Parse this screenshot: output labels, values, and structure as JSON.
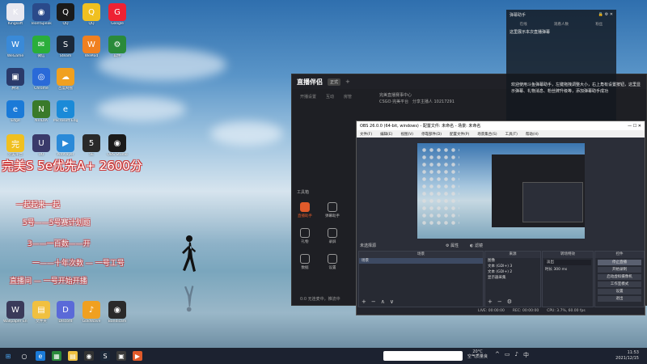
{
  "desktop": {
    "icons": [
      {
        "label": "Kingsoft",
        "color": "#e8e8f0",
        "glyph": "K"
      },
      {
        "label": "TeamSpeak",
        "color": "#2a4a8a",
        "glyph": "◉"
      },
      {
        "label": "QQ",
        "color": "#1a1a1a",
        "glyph": "Q"
      },
      {
        "label": "QQ",
        "color": "#f0c020",
        "glyph": "Q"
      },
      {
        "label": "Google",
        "color": "#e23",
        "glyph": "G"
      },
      {
        "label": "WeGame",
        "color": "#3a8ad8",
        "glyph": "W"
      },
      {
        "label": "微信",
        "color": "#2aae3a",
        "glyph": "✉"
      },
      {
        "label": "Steam",
        "color": "#1b2838",
        "glyph": "S"
      },
      {
        "label": "WeMod",
        "color": "#f08020",
        "glyph": "W"
      },
      {
        "label": "软件",
        "color": "#2a8a3a",
        "glyph": "⚙"
      },
      {
        "label": "腾讯",
        "color": "#2a3a6a",
        "glyph": "▣"
      },
      {
        "label": "Chrome",
        "color": "#2a6ad8",
        "glyph": "◎"
      },
      {
        "label": "百度网盘",
        "color": "#f0a020",
        "glyph": "☁"
      },
      {
        "label": "Edge",
        "color": "#1a7ad8",
        "glyph": "e"
      },
      {
        "label": "NVIDIA",
        "color": "#3a7a2a",
        "glyph": "N"
      },
      {
        "label": "Microsoft Edge",
        "color": "#1a8ad8",
        "glyph": "e"
      },
      {
        "label": "完美平台",
        "color": "#f0c020",
        "glyph": "完"
      },
      {
        "label": "UU",
        "color": "#3a3a6a",
        "glyph": "U"
      },
      {
        "label": "PotPlayer",
        "color": "#2a8ad8",
        "glyph": "▶"
      },
      {
        "label": "5E",
        "color": "#2a2a2a",
        "glyph": "5"
      },
      {
        "label": "OBS Studio",
        "color": "#1a1a1a",
        "glyph": "◉"
      },
      {
        "label": "Wallpaper Engine",
        "color": "#3a3a5a",
        "glyph": "W"
      },
      {
        "label": "文件夹",
        "color": "#f0c040",
        "glyph": "▤"
      },
      {
        "label": "Discord",
        "color": "#5a6ad8",
        "glyph": "D"
      },
      {
        "label": "GoldWave",
        "color": "#f0a020",
        "glyph": "♪"
      },
      {
        "label": "Bandicam",
        "color": "#2a2a2a",
        "glyph": "◉"
      }
    ],
    "overlay_big": "完美S 5e优先A+ 2600分",
    "overlay_lines": [
      "一起起来一起",
      "5号——5号赛计划题",
      "3——一百数——开",
      "一——十年次数 — 一号工号",
      "直播间 — 一号开始开播"
    ]
  },
  "live_app": {
    "logo": "直播伴侣",
    "badge": "正式",
    "tabs": [
      "开播设置",
      "互动",
      "房管"
    ],
    "info_lines": [
      "完美直播赛事中心",
      "CSGO·完美平台",
      "分享主播人",
      "10217291"
    ],
    "tools_label": "工具箱",
    "tools": [
      {
        "label": "直播助手",
        "active": true
      },
      {
        "label": "弹幕助手",
        "active": false
      },
      {
        "label": "礼物",
        "active": false
      },
      {
        "label": "录屏",
        "active": false
      },
      {
        "label": "数据",
        "active": false
      },
      {
        "label": "设置",
        "active": false
      }
    ],
    "status": "0:0 无连麦中，推流中"
  },
  "chat": {
    "title": "弹幕助手",
    "stats": [
      "在线",
      "观看人数",
      "粉丝"
    ],
    "message": "这里展示本次直播弹幕",
    "welcome": "欢迎使用斗鱼弹幕助手，左键拖拽调整大小，右上角有设置按钮，这里显示弹幕、礼物消息、粉丝牌升级等，添加弹幕助手成功"
  },
  "obs": {
    "title": "OBS 26.0.0 (64-bit, windows) - 配置文件: 未命名 - 场景: 未命名",
    "menu": [
      "文件(F)",
      "编辑(E)",
      "视图(V)",
      "停靠部件(D)",
      "配置文件(P)",
      "场景集合(S)",
      "工具(T)",
      "帮助(H)"
    ],
    "no_source": "未选择源",
    "controls": [
      "属性",
      "滤镜"
    ],
    "docks": {
      "scenes": {
        "title": "场景",
        "items": [
          "场景"
        ]
      },
      "sources": {
        "title": "来源",
        "items": [
          "图像",
          "文本 (GDI+) 3",
          "文本 (GDI+) 2",
          "显示器采集"
        ]
      },
      "transitions": {
        "title": "转场特效",
        "value": "淡出",
        "duration_label": "时长",
        "duration": "300 ms"
      },
      "controls": {
        "title": "控件",
        "buttons": [
          "停止直播",
          "开始录制",
          "启动虚拟摄像机",
          "工作室模式",
          "设置",
          "退出"
        ]
      }
    },
    "status": [
      "LIVE: 00:00:00",
      "REC: 00:00:00",
      "CPU: 3.7%, 60.00 fps"
    ]
  },
  "taskbar": {
    "weather": [
      "20°C",
      "空气质量良"
    ],
    "time": "11:53",
    "date": "2021/12/15"
  }
}
